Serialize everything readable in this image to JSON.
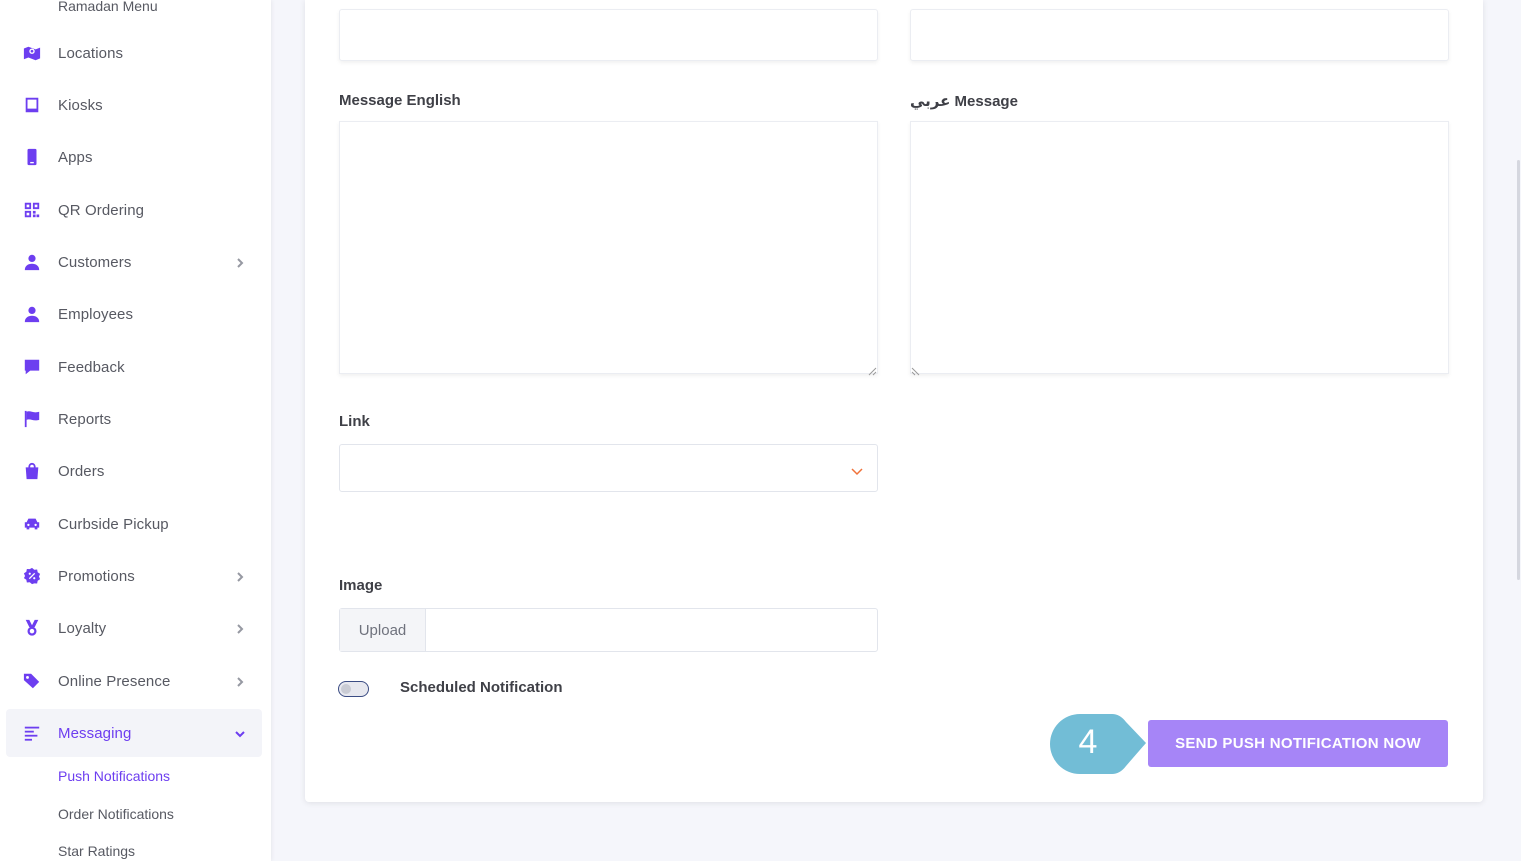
{
  "sidebar": {
    "cut_top_item": "Ramadan Menu",
    "items": [
      {
        "label": "Locations",
        "icon": "map-location-icon"
      },
      {
        "label": "Kiosks",
        "icon": "tablet-icon"
      },
      {
        "label": "Apps",
        "icon": "mobile-icon"
      },
      {
        "label": "QR Ordering",
        "icon": "qr-code-icon"
      },
      {
        "label": "Customers",
        "icon": "user-icon",
        "has_submenu": true
      },
      {
        "label": "Employees",
        "icon": "user-icon"
      },
      {
        "label": "Feedback",
        "icon": "comment-icon"
      },
      {
        "label": "Reports",
        "icon": "flag-icon"
      },
      {
        "label": "Orders",
        "icon": "shopping-bag-icon"
      },
      {
        "label": "Curbside Pickup",
        "icon": "car-icon"
      },
      {
        "label": "Promotions",
        "icon": "percent-badge-icon",
        "has_submenu": true
      },
      {
        "label": "Loyalty",
        "icon": "medal-icon",
        "has_submenu": true
      },
      {
        "label": "Online Presence",
        "icon": "tags-icon",
        "has_submenu": true
      },
      {
        "label": "Messaging",
        "icon": "align-left-icon",
        "has_submenu": true,
        "expanded": true,
        "active": true
      }
    ],
    "messaging_submenu": [
      {
        "label": "Push Notifications",
        "active": true
      },
      {
        "label": "Order Notifications"
      },
      {
        "label": "Star Ratings"
      }
    ]
  },
  "form": {
    "message_english_label": "Message English",
    "message_arabic_label": "عربي Message",
    "message_english_value": "",
    "message_arabic_value": "",
    "link_label": "Link",
    "link_selected": "",
    "image_label": "Image",
    "upload_label": "Upload",
    "scheduled_label": "Scheduled Notification",
    "scheduled_on": false,
    "send_button": "SEND PUSH NOTIFICATION NOW"
  },
  "annotation": {
    "step_number": "4"
  },
  "colors": {
    "accent": "#6d3ef0",
    "send_button": "#a685f7",
    "step_marker": "#72bdd6",
    "select_arrow": "#f0723a"
  }
}
